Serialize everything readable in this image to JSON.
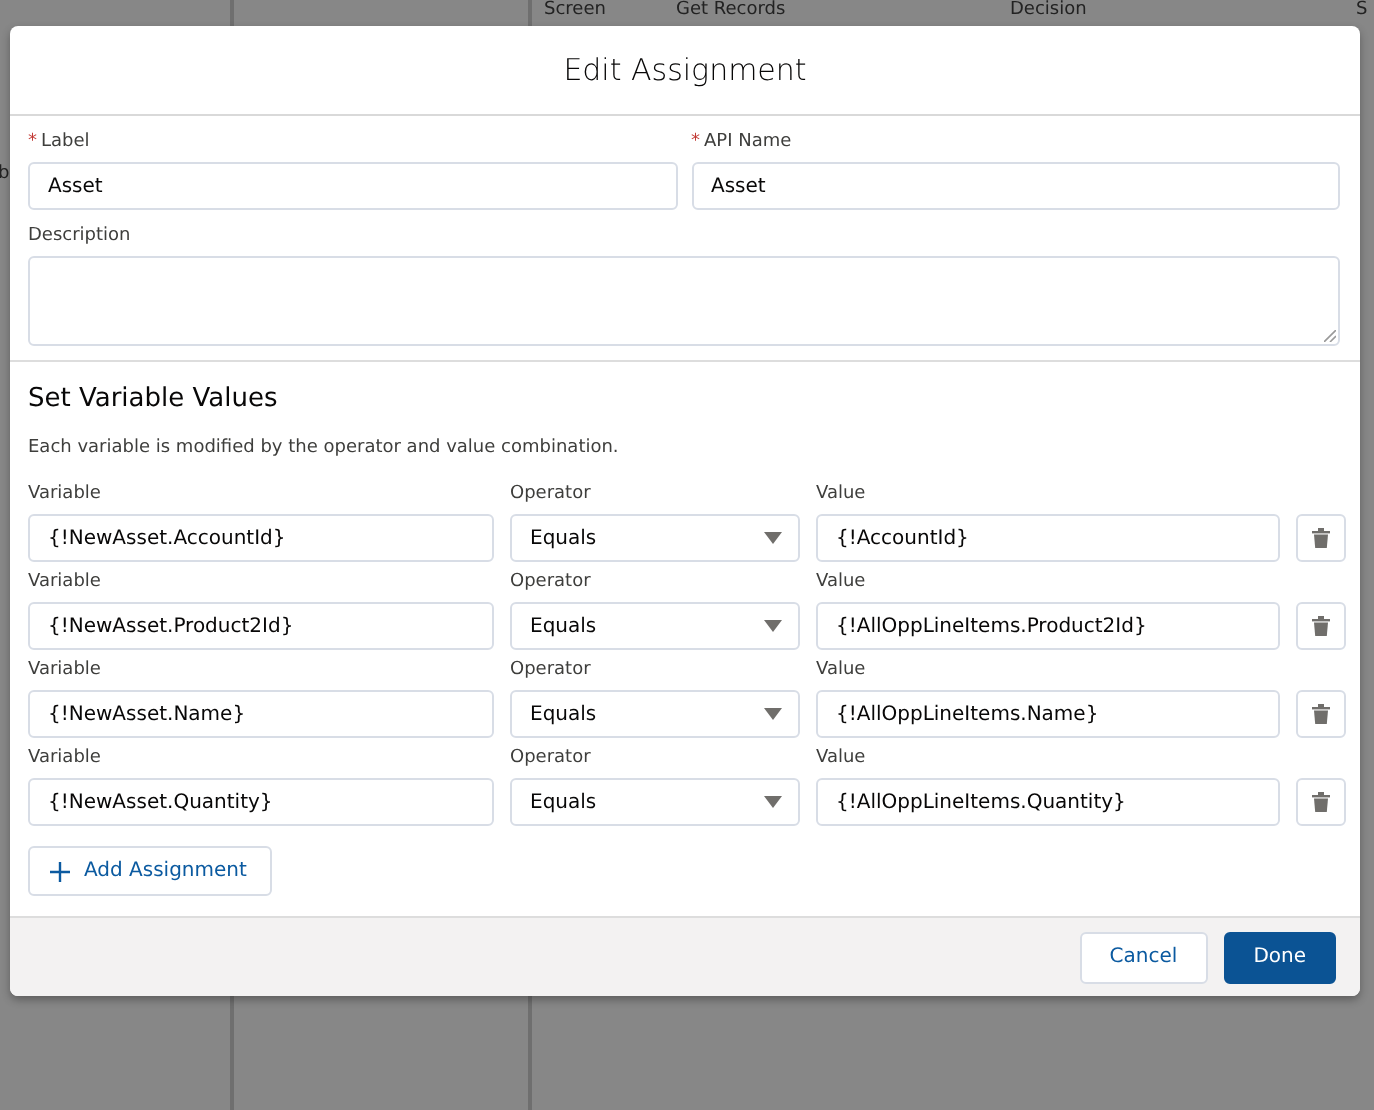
{
  "canvas": {
    "labels": [
      "Screen",
      "Get Records",
      "Decision",
      "b",
      "S"
    ]
  },
  "dialog": {
    "title": "Edit Assignment",
    "label_field": {
      "label": "Label",
      "required_mark": "*",
      "value": "Asset"
    },
    "api_name_field": {
      "label": "API Name",
      "required_mark": "*",
      "value": "Asset"
    },
    "description_field": {
      "label": "Description"
    },
    "section": {
      "title": "Set Variable Values",
      "help": "Each variable is modified by the operator and value combination."
    },
    "assignments": [
      {
        "variable_label": "Variable",
        "variable": "{!NewAsset.AccountId}",
        "operator_label": "Operator",
        "operator": "Equals",
        "value_label": "Value",
        "value": "{!AccountId}"
      },
      {
        "variable_label": "Variable",
        "variable": "{!NewAsset.Product2Id}",
        "operator_label": "Operator",
        "operator": "Equals",
        "value_label": "Value",
        "value": "{!AllOppLineItems.Product2Id}"
      },
      {
        "variable_label": "Variable",
        "variable": "{!NewAsset.Name}",
        "operator_label": "Operator",
        "operator": "Equals",
        "value_label": "Value",
        "value": "{!AllOppLineItems.Name}"
      },
      {
        "variable_label": "Variable",
        "variable": "{!NewAsset.Quantity}",
        "operator_label": "Operator",
        "operator": "Equals",
        "value_label": "Value",
        "value": "{!AllOppLineItems.Quantity}"
      }
    ],
    "add_button": "Add Assignment",
    "buttons": [
      {
        "label": "Cancel",
        "kind": "neutral"
      },
      {
        "label": "Done",
        "kind": "brand"
      }
    ]
  }
}
